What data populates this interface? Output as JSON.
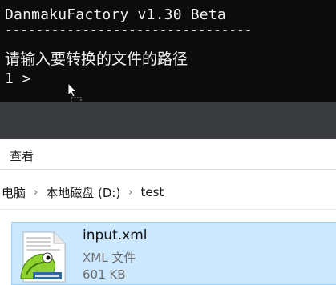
{
  "console": {
    "title": "DanmakuFactory v1.30 Beta",
    "separator": "--------------------------------",
    "prompt_text": "请输入要转换的文件的路径",
    "prompt": "1 >"
  },
  "explorer": {
    "ribbon_tab": "查看",
    "breadcrumb": [
      {
        "label": "电脑"
      },
      {
        "label": "本地磁盘 (D:)"
      },
      {
        "label": "test"
      }
    ],
    "file": {
      "name": "input.xml",
      "type": "XML 文件",
      "size": "601 KB"
    }
  },
  "colors": {
    "console_bg": "#0c0c0c",
    "selection_bg": "#cce8ff",
    "selection_border": "#99d1ff"
  },
  "icons": {
    "cursor": "drag-copy-cursor-icon",
    "file": "notepadpp-xml-file-icon",
    "chevron": "chevron-right-icon"
  }
}
